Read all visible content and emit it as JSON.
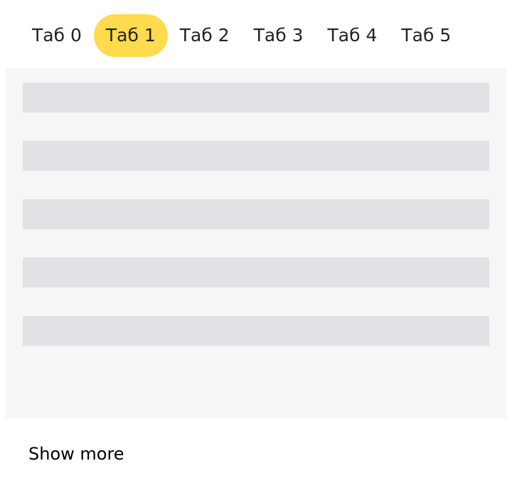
{
  "tabs": [
    {
      "label": "Таб 0",
      "active": false
    },
    {
      "label": "Таб 1",
      "active": true
    },
    {
      "label": "Таб 2",
      "active": false
    },
    {
      "label": "Таб 3",
      "active": false
    },
    {
      "label": "Таб 4",
      "active": false
    },
    {
      "label": "Таб 5",
      "active": false
    }
  ],
  "colors": {
    "active_tab": "#ffdb4d",
    "panel_background": "#f6f6f6",
    "skeleton": "#e1e2e5"
  },
  "content": {
    "loading_placeholder_count": 5
  },
  "footer": {
    "show_more_label": "Show more"
  }
}
